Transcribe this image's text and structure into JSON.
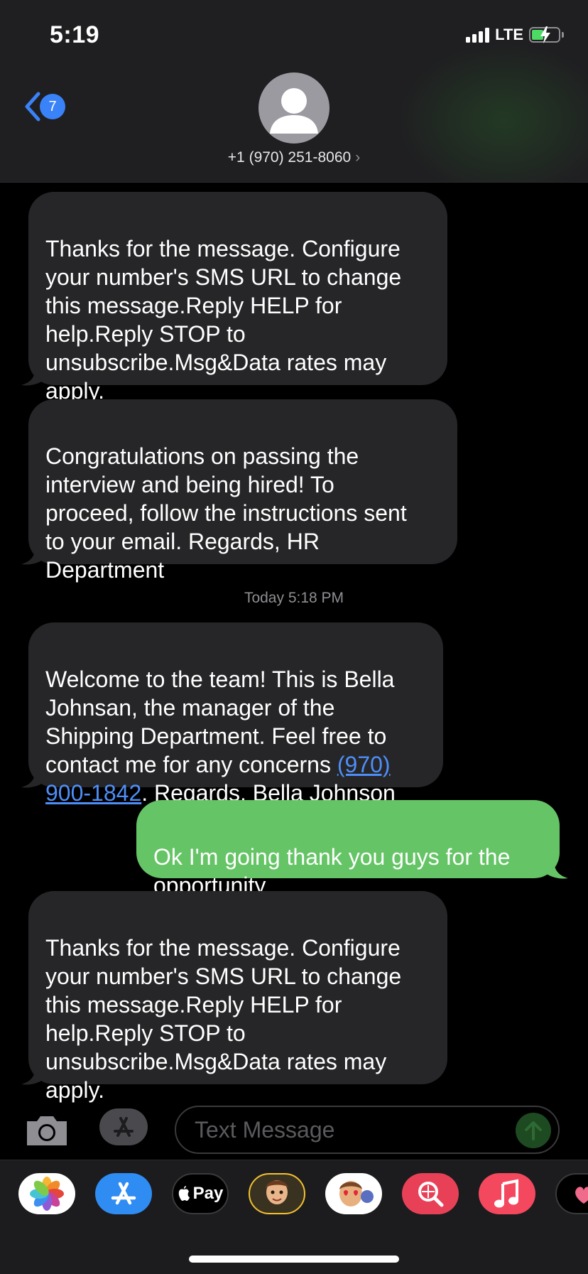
{
  "status_bar": {
    "time": "5:19",
    "network": "LTE"
  },
  "header": {
    "back_count": "7",
    "contact": "+1 (970) 251-8060",
    "chevron": "›"
  },
  "messages": [
    {
      "from": "them",
      "text": "Thanks for the message. Configure\nyour number's SMS URL to change\nthis message.Reply HELP for\nhelp.Reply STOP to\nunsubscribe.Msg&Data rates may\napply."
    },
    {
      "from": "them",
      "text": "Congratulations on passing the\ninterview and being hired! To\nproceed, follow the instructions sent\nto your email. Regards, HR\nDepartment"
    },
    {
      "from": "them",
      "text_before": "Welcome to the team! This is Bella\nJohnsan, the manager of the\nShipping Department. Feel free to\ncontact me for any concerns ",
      "link_1": "(970)",
      "link_2": "900-1842",
      "text_after": ". Regards, Bella Johnson"
    },
    {
      "from": "me",
      "text": "Ok I'm going thank you guys for the\nopportunity"
    },
    {
      "from": "them",
      "text": "Thanks for the message. Configure\nyour number's SMS URL to change\nthis message.Reply HELP for\nhelp.Reply STOP to\nunsubscribe.Msg&Data rates may\napply."
    }
  ],
  "timestamp": "Today 5:18 PM",
  "composer": {
    "placeholder": "Text Message"
  },
  "app_tray": [
    {
      "icon": "photos-icon"
    },
    {
      "icon": "app-store-icon"
    },
    {
      "icon": "apple-pay-icon",
      "label": "Pay"
    },
    {
      "icon": "memoji-stickers-icon"
    },
    {
      "icon": "animoji-icon"
    },
    {
      "icon": "search-images-icon"
    },
    {
      "icon": "music-icon"
    },
    {
      "icon": "digital-touch-icon"
    }
  ],
  "colors": {
    "incoming": "#262628",
    "outgoing": "#65c466",
    "link": "#4e8ef7",
    "accent": "#3a82f7"
  }
}
